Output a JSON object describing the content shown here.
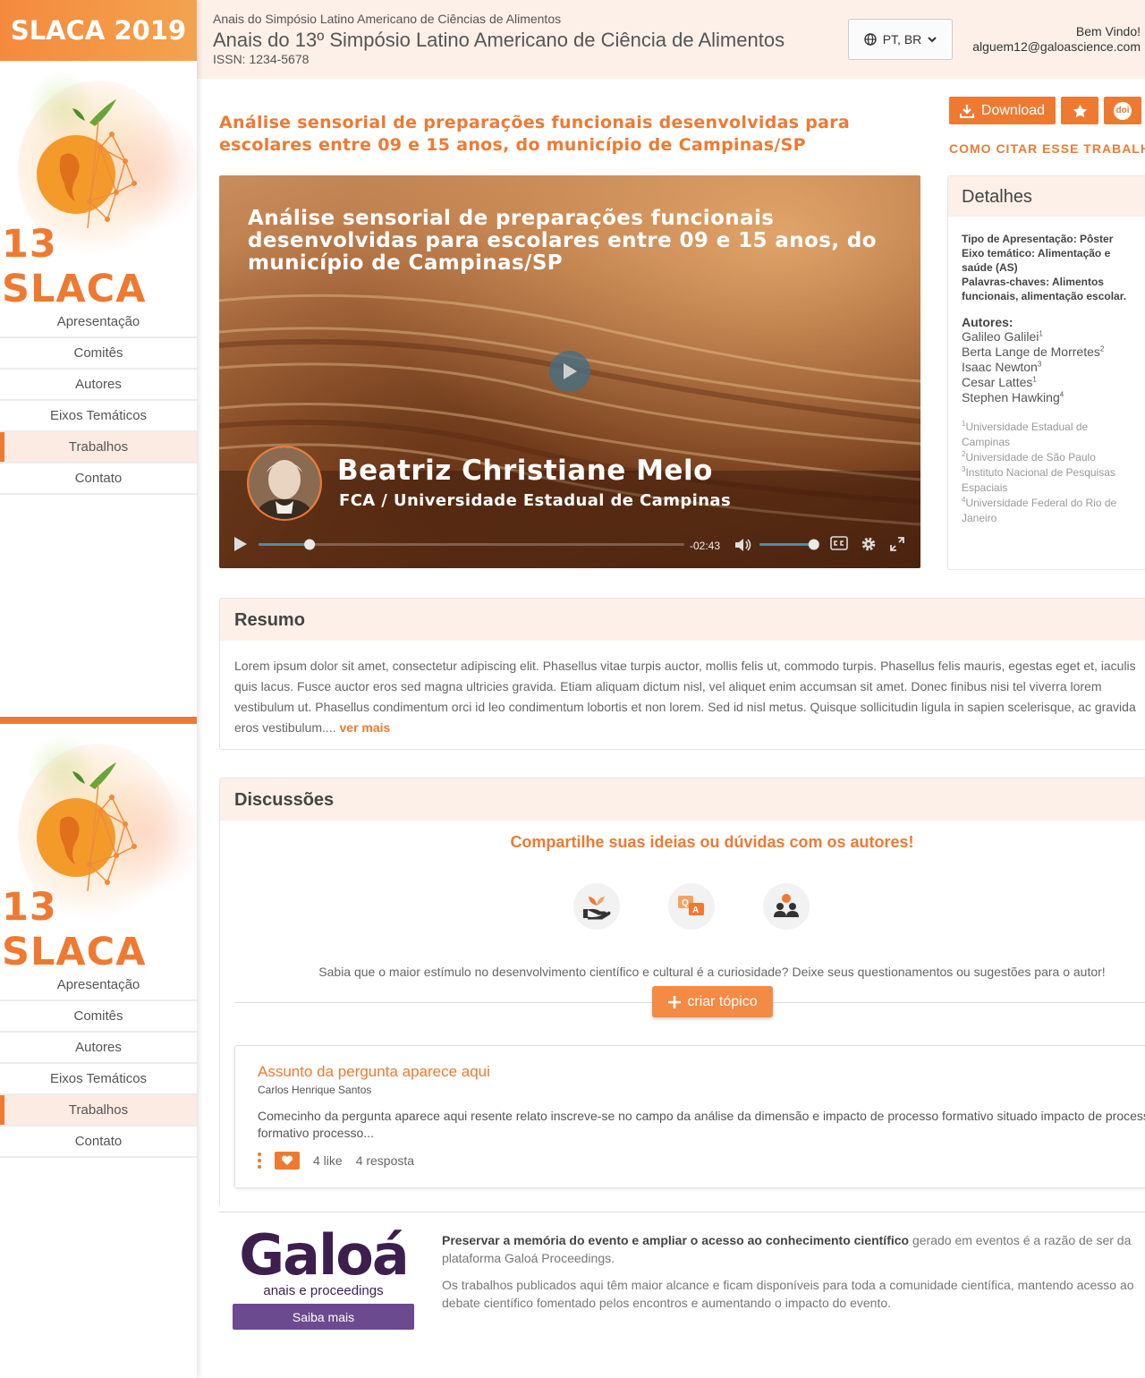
{
  "sidebar": {
    "brand": "SLACA 2019",
    "logo_text": "13 SLACA",
    "nav": [
      {
        "label": "Apresentação"
      },
      {
        "label": "Comitês"
      },
      {
        "label": "Autores"
      },
      {
        "label": "Eixos Temáticos"
      },
      {
        "label": "Trabalhos",
        "active": true
      },
      {
        "label": "Contato"
      }
    ]
  },
  "header": {
    "event_small": "Anais do Simpósio Latino Americano de Ciências de Alimentos",
    "event_title": "Anais do 13º Simpósio Latino Americano de Ciência de Alimentos",
    "issn": "ISSN: 1234-5678",
    "language": "PT, BR",
    "welcome": "Bem Vindo!",
    "user_email": "alguem12@galoascience.com"
  },
  "work": {
    "title": "Análise sensorial de preparações funcionais desenvolvidas para escolares entre 09 e 15 anos, do município de Campinas/SP",
    "download_label": "Download",
    "cite_label": "COMO CITAR ESSE TRABALHO?",
    "doi_label": "doi"
  },
  "video": {
    "title": "Análise sensorial de preparações funcionais desenvolvidas para escolares entre 09 e 15 anos, do município de Campinas/SP",
    "presenter": "Beatriz Christiane Melo",
    "institution": "FCA / Universidade Estadual de Campinas",
    "time_remaining": "-02:43",
    "progress": 0.12,
    "volume": 0.95
  },
  "details": {
    "heading": "Detalhes",
    "meta": [
      "Tipo de Apresentação: Pôster",
      "Eixo temático: Alimentação e saúde (AS)",
      "Palavras-chaves: Alimentos funcionais, alimentação escolar."
    ],
    "authors_heading": "Autores:",
    "authors": [
      {
        "name": "Galileo Galilei",
        "sup": "1"
      },
      {
        "name": "Berta Lange de Morretes",
        "sup": "2"
      },
      {
        "name": "Isaac Newton",
        "sup": "3"
      },
      {
        "name": "Cesar Lattes",
        "sup": "1"
      },
      {
        "name": "Stephen Hawking",
        "sup": "4"
      }
    ],
    "affiliations": [
      {
        "sup": "1",
        "name": "Universidade Estadual de Campinas"
      },
      {
        "sup": "2",
        "name": "Universidade de São Paulo"
      },
      {
        "sup": "3",
        "name": "Instituto Nacional de Pesquisas Espaciais"
      },
      {
        "sup": "4",
        "name": "Universidade Federal do Rio de Janeiro"
      }
    ]
  },
  "resumo": {
    "heading": "Resumo",
    "text": "Lorem ipsum dolor sit amet, consectetur adipiscing elit. Phasellus vitae turpis auctor, mollis felis ut, commodo turpis. Phasellus felis mauris, egestas eget et, iaculis quis lacus. Fusce auctor eros sed magna ultricies gravida. Etiam aliquam dictum nisl, vel aliquet enim accumsan sit amet. Donec finibus nisi tel viverra lorem vestibulum ut. Phasellus condimentum orci id leo condimentum lobortis et non lorem. Sed id nisl metus. Quisque sollicitudin ligula in sapien scelerisque, ac gravida eros vestibulum....",
    "more_label": "ver mais"
  },
  "discussions": {
    "heading": "Discussões",
    "call": "Compartilhe suas ideias ou dúvidas com os autores!",
    "icons": [
      "hand-plant-icon",
      "qa-chat-icon",
      "people-icon"
    ],
    "text": "Sabia que o maior estímulo no desenvolvimento científico e cultural é a curiosidade? Deixe seus questionamentos ou sugestões para o autor!",
    "create_label": "criar tópico",
    "topic": {
      "title": "Assunto da pergunta aparece aqui",
      "author": "Carlos Henrique Santos",
      "excerpt": "Comecinho da pergunta aparece aqui resente relato inscreve-se no campo da análise da dimensão e impacto de processo formativo situado impacto de processo formativo processo...",
      "likes": "4 like",
      "replies": "4 resposta"
    }
  },
  "footer": {
    "brand": "Galoá",
    "brand_sub": "anais e proceedings",
    "cta": "Saiba mais",
    "p1_bold": "Preservar a memória do evento e ampliar o acesso ao conhecimento científico",
    "p1_rest": " gerado em eventos é a razão de ser da plataforma Galoá Proceedings.",
    "p2": "Os trabalhos publicados aqui têm maior alcance e ficam disponíveis para toda a comunidade científica, mantendo acesso ao debate científico fomentado pelos encontros e aumentando o impacto do evento."
  },
  "colors": {
    "accent": "#ee7a32",
    "header_bg": "#fdf0e8",
    "galoa": "#3d1f4e"
  }
}
